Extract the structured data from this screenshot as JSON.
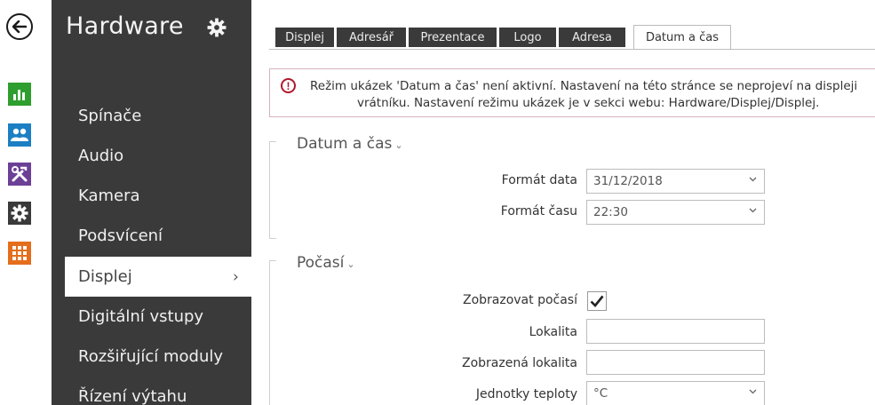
{
  "colors": {
    "sidebar_bg": "#3a3a3a",
    "accent_green": "#2e9e2e",
    "accent_blue": "#1c7fc4",
    "accent_purple": "#6c3f97",
    "accent_orange": "#e46e1c",
    "alert_red": "#b0192d"
  },
  "rail": {
    "icons": [
      "back-arrow-icon",
      "bar-chart-icon",
      "users-icon",
      "tools-icon",
      "gear-icon",
      "grid-icon"
    ]
  },
  "sidebar": {
    "title": "Hardware",
    "items": [
      {
        "label": "Spínače"
      },
      {
        "label": "Audio"
      },
      {
        "label": "Kamera"
      },
      {
        "label": "Podsvícení"
      },
      {
        "label": "Displej",
        "active": true,
        "chevron": "›"
      },
      {
        "label": "Digitální vstupy"
      },
      {
        "label": "Rozšiřující moduly"
      },
      {
        "label": "Řízení výtahu"
      }
    ]
  },
  "tabs": [
    {
      "label": "Displej"
    },
    {
      "label": "Adresář"
    },
    {
      "label": "Prezentace"
    },
    {
      "label": "Logo"
    },
    {
      "label": "Adresa"
    },
    {
      "label": "Datum a čas",
      "active": true
    }
  ],
  "alert": {
    "icon": "!",
    "line1": "Režim ukázek 'Datum a čas' není aktivní. Nastavení na této stránce se neprojeví na displeji",
    "line2": "vrátníku. Nastavení režimu ukázek je v sekci webu: Hardware/Displej/Displej."
  },
  "datetime_section": {
    "title": "Datum a čas",
    "caret": "⌄",
    "date_format": {
      "label": "Formát data",
      "value": "31/12/2018"
    },
    "time_format": {
      "label": "Formát času",
      "value": "22:30"
    }
  },
  "weather_section": {
    "title": "Počasí",
    "caret": "⌄",
    "show_weather": {
      "label": "Zobrazovat počasí",
      "checked": true
    },
    "location": {
      "label": "Lokalita",
      "value": ""
    },
    "display_location": {
      "label": "Zobrazená lokalita",
      "value": ""
    },
    "temp_units": {
      "label": "Jednotky teploty",
      "value": "°C"
    }
  }
}
